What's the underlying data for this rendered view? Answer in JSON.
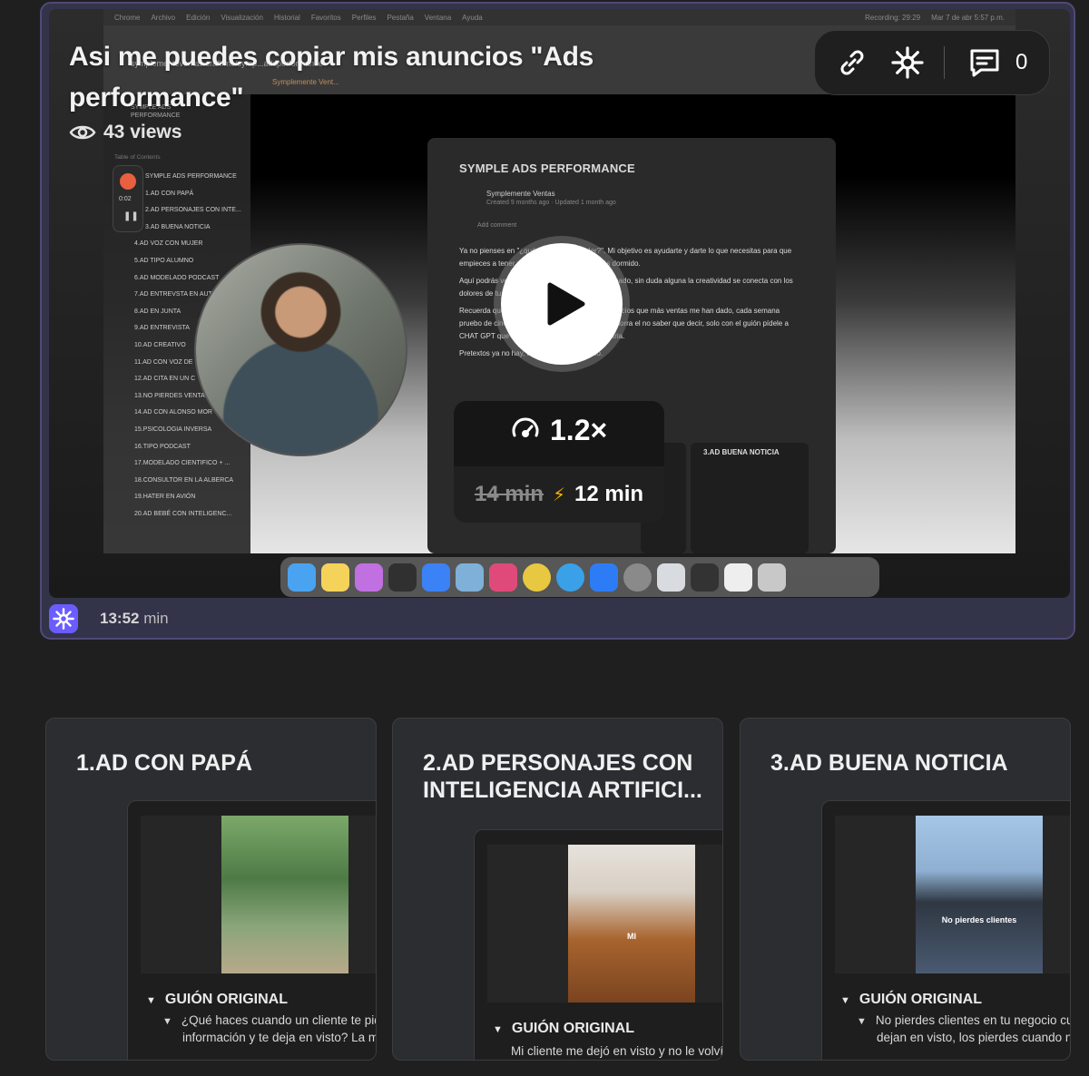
{
  "video": {
    "title": "Asi me puedes copiar mis anuncios \"Ads performance\"",
    "views": "43 views",
    "comment_count": "0",
    "duration_value": "13:52",
    "duration_unit": "min",
    "speed": "1.2×",
    "old_time": "14 min",
    "new_time": "12 min"
  },
  "screen": {
    "menubar": [
      "Chrome",
      "Archivo",
      "Edición",
      "Visualización",
      "Historial",
      "Favoritos",
      "Perfiles",
      "Pestaña",
      "Ventana",
      "Ayuda"
    ],
    "recording": "Recording: 29:29",
    "clock": "Mar 7 de abr 5:57 p.m.",
    "url": "symplementeventas.craft.me/symp...adsperformance",
    "tab": "Symplemente Vent...",
    "sidebar_title": "SYMPLE ADS PERFORMANCE",
    "toc_label": "Table of Contents",
    "rec_time": "0:02",
    "toc": [
      "SYMPLE ADS PERFORMANCE",
      "1.AD CON PAPÁ",
      "2.AD PERSONAJES CON INTE...",
      "3.AD BUENA NOTICIA",
      "4.AD VOZ CON MUJER",
      "5.AD TIPO ALUMNO",
      "6.AD MODELADO PODCAST",
      "7.AD ENTREVSTA EN AUTO",
      "8.AD EN JUNTA",
      "9.AD ENTREVISTA",
      "10.AD CREATIVO",
      "11.AD CON VOZ DE",
      "12.AD CITA EN UN C",
      "13.NO PIERDES VENTAS",
      "14.AD CON ALONSO MOR",
      "15.PSICOLOGIA INVERSA",
      "16.TIPO PODCAST",
      "17.MODELADO CIENTIFICO + ...",
      "18.CONSULTOR EN LA ALBERCA",
      "19.HATER EN AVIÓN",
      "20.AD BEBÉ CON INTELIGENC..."
    ],
    "doc_heading": "SYMPLE ADS PERFORMANCE",
    "doc_author": "Symplemente Ventas",
    "doc_meta": "Created 9 months ago  ·  Updated 1 month ago",
    "doc_comment": "Add comment",
    "doc_paragraphs": [
      "Ya no pienses en \"¿qué hacer para vender?\". Mi objetivo es ayudarte y darte lo que necesitas para que empieces a tener ventas, incluso cuando estás dormido.",
      "Aquí podrás ver los anuncios que me han funcionado, sin duda alguna la creatividad se conecta con los dolores de tu cliente.",
      "Recuerda que este es un documento con los anuncios que más ventas me han dado, cada semana pruebo de cinco a ocho anuncios diferentes, te ahorra el no saber que decir, solo con el guión pídele a CHAT GPT que te ayude a adecuarlo a tu industria.",
      "Pretextos ya no hay, así que a vender genio."
    ],
    "doc_card_label": "3.AD BUENA NOTICIA"
  },
  "cards": [
    {
      "title": "1.AD CON PAPÁ",
      "script_label": "GUIÓN ORIGINAL",
      "lines": [
        "¿Qué haces cuando un cliente te pid",
        "información y te deja en visto? La ma"
      ]
    },
    {
      "title": "2.AD PERSONAJES CON INTELIGENCIA ARTIFICI...",
      "script_label": "GUIÓN ORIGINAL",
      "lines": [
        "Mi cliente me dejó en visto y no le volví"
      ],
      "image_caption": "MI"
    },
    {
      "title": "3.AD BUENA NOTICIA",
      "script_label": "GUIÓN ORIGINAL",
      "lines": [
        "No pierdes clientes en tu negocio cu",
        "dejan en visto, los pierdes cuando no"
      ],
      "image_caption": "No pierdes clientes"
    }
  ],
  "colors": {
    "accent": "#6a5cff",
    "card_border": "#4f4a78",
    "background": "#1f1f1f"
  }
}
